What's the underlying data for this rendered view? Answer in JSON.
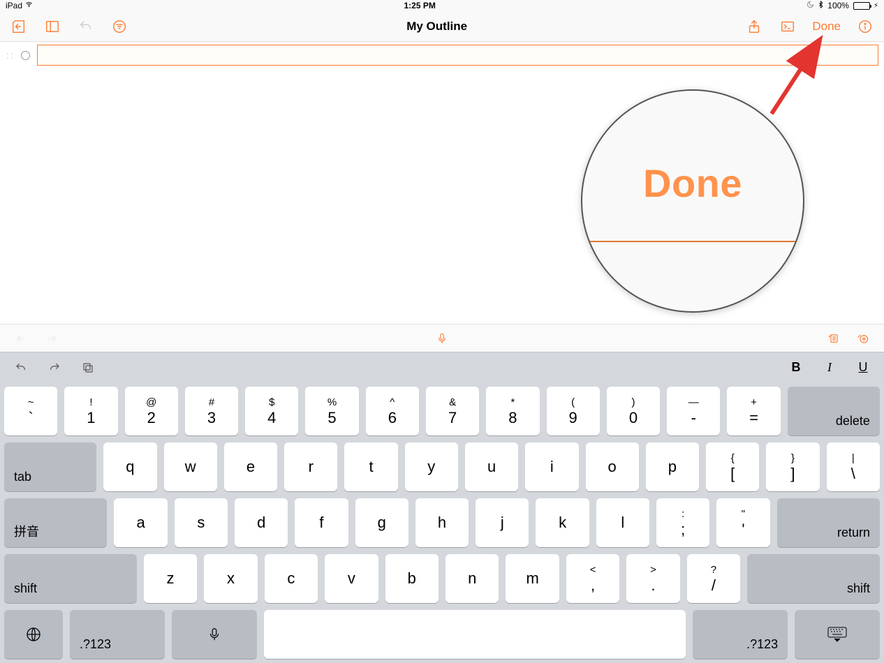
{
  "status": {
    "device": "iPad",
    "time": "1:25 PM",
    "battery_pct": "100%"
  },
  "toolbar": {
    "title": "My Outline",
    "done": "Done"
  },
  "outline": {
    "row_value": ""
  },
  "callout": {
    "text": "Done"
  },
  "format": {
    "bold": "B",
    "italic": "I",
    "underline": "U"
  },
  "keyboard": {
    "row1": [
      {
        "sup": "~",
        "sub": "`"
      },
      {
        "sup": "!",
        "sub": "1"
      },
      {
        "sup": "@",
        "sub": "2"
      },
      {
        "sup": "#",
        "sub": "3"
      },
      {
        "sup": "$",
        "sub": "4"
      },
      {
        "sup": "%",
        "sub": "5"
      },
      {
        "sup": "^",
        "sub": "6"
      },
      {
        "sup": "&",
        "sub": "7"
      },
      {
        "sup": "*",
        "sub": "8"
      },
      {
        "sup": "(",
        "sub": "9"
      },
      {
        "sup": ")",
        "sub": "0"
      },
      {
        "sup": "—",
        "sub": "-"
      },
      {
        "sup": "+",
        "sub": "="
      }
    ],
    "delete": "delete",
    "tab": "tab",
    "row2": [
      "q",
      "w",
      "e",
      "r",
      "t",
      "y",
      "u",
      "i",
      "o",
      "p"
    ],
    "row2_sym": [
      {
        "sup": "{",
        "sub": "["
      },
      {
        "sup": "}",
        "sub": "]"
      },
      {
        "sup": "|",
        "sub": "\\"
      }
    ],
    "pinyin": "拼音",
    "row3": [
      "a",
      "s",
      "d",
      "f",
      "g",
      "h",
      "j",
      "k",
      "l"
    ],
    "row3_sym": [
      {
        "sup": ":",
        "sub": ";"
      },
      {
        "sup": "\"",
        "sub": "'"
      }
    ],
    "return": "return",
    "shift": "shift",
    "row4": [
      "z",
      "x",
      "c",
      "v",
      "b",
      "n",
      "m"
    ],
    "row4_sym": [
      {
        "sup": "<",
        "sub": ","
      },
      {
        "sup": ">",
        "sub": "."
      },
      {
        "sup": "?",
        "sub": "/"
      }
    ],
    "numsym": ".?123"
  }
}
